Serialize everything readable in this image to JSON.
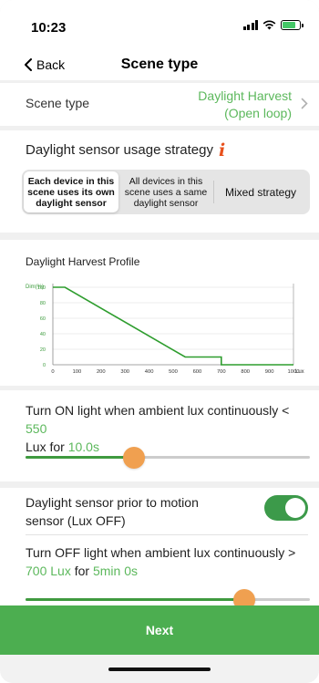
{
  "status_bar": {
    "time": "10:23"
  },
  "nav": {
    "back_label": "Back",
    "title": "Scene type"
  },
  "scene_type": {
    "label": "Scene type",
    "value_line1": "Daylight Harvest",
    "value_line2": "(Open loop)"
  },
  "strategy": {
    "title": "Daylight sensor usage strategy",
    "options": [
      {
        "label": "Each device in this scene uses its own daylight sensor",
        "selected": true
      },
      {
        "label": "All devices in this scene uses a same daylight sensor",
        "selected": false
      },
      {
        "label": "Mixed strategy",
        "selected": false
      }
    ]
  },
  "chart_data": {
    "type": "line",
    "title": "Daylight Harvest Profile",
    "ylabel": "Dim(%)",
    "xlabel": "Lux",
    "x_ticks": [
      "0",
      "100",
      "200",
      "300",
      "400",
      "500",
      "600",
      "700",
      "800",
      "900",
      "1000"
    ],
    "y_ticks": [
      "0",
      "20",
      "40",
      "60",
      "80",
      "100"
    ],
    "xlim": [
      0,
      1000
    ],
    "ylim": [
      0,
      100
    ],
    "grid": true,
    "series": [
      {
        "x": [
          0,
          50,
          550,
          700,
          700,
          1000
        ],
        "y": [
          100,
          100,
          10,
          10,
          0,
          0
        ],
        "color": "#2e9d2e"
      }
    ]
  },
  "turn_on": {
    "prefix": "Turn ON light when ambient lux continuously <",
    "lux_value": "550",
    "lux_unit": "Lux",
    "for_word": "for",
    "duration": "10.0s",
    "slider_fraction": 0.38
  },
  "motion_priority": {
    "label": "Daylight sensor prior to motion sensor (Lux OFF)",
    "enabled": true
  },
  "turn_off": {
    "prefix": "Turn OFF light when ambient lux continuously >",
    "lux_value": "700 Lux",
    "for_word": "for",
    "duration": "5min 0s",
    "slider_fraction": 0.77
  },
  "next_label": "Next",
  "colors": {
    "accent_green": "#4cae50",
    "value_green": "#5cb85c",
    "knob_orange": "#f0a050",
    "info_red": "#e8501c"
  }
}
